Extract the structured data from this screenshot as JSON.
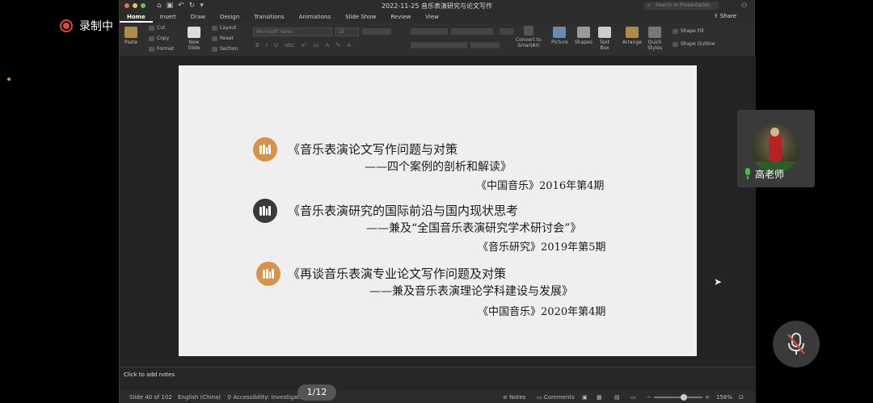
{
  "recording": {
    "label": "录制中"
  },
  "window": {
    "title": "2022-11-25 音乐表演研究与论文写作",
    "search_placeholder": "Search in Presentation",
    "share_label": "Share",
    "tabs": [
      "Home",
      "Insert",
      "Draw",
      "Design",
      "Transitions",
      "Animations",
      "Slide Show",
      "Review",
      "View"
    ]
  },
  "ribbon": {
    "paste": "Paste",
    "cut": "Cut",
    "copy": "Copy",
    "format": "Format",
    "new_slide": "New\nSlide",
    "layout": "Layout",
    "reset": "Reset",
    "section": "Section",
    "font_name": "Microsoft YaHei",
    "font_size": "18",
    "convert": "Convert to\nSmartArt",
    "picture": "Picture",
    "shapes": "Shapes",
    "text_box": "Text\nBox",
    "arrange": "Arrange",
    "quick_styles": "Quick\nStyles",
    "shape_fill": "Shape Fill",
    "shape_outline": "Shape Outline"
  },
  "slide": {
    "entries": [
      {
        "title": "《音乐表演论文写作问题与对策",
        "subtitle": "——四个案例的剖析和解读》",
        "source": "《中国音乐》2016年第4期",
        "badge_color": "#d8924a"
      },
      {
        "title": "《音乐表演研究的国际前沿与国内现状思考",
        "subtitle": "——兼及“全国音乐表演研究学术研讨会”》",
        "source": "《音乐研究》2019年第5期",
        "badge_color": "#3a3a3a"
      },
      {
        "title": "《再谈音乐表演专业论文写作问题及对策",
        "subtitle": "——兼及音乐表演理论学科建设与发展》",
        "source": "《中国音乐》2020年第4期",
        "badge_color": "#d8924a"
      }
    ]
  },
  "notes": {
    "placeholder": "Click to add notes"
  },
  "status": {
    "slide_info": "Slide 40 of 102",
    "language": "English (China)",
    "accessibility": "Accessibility: Investigate",
    "notes": "Notes",
    "comments": "Comments",
    "zoom": "156%",
    "zoom_level": 0.62
  },
  "pager": {
    "label": "1/12"
  },
  "participant": {
    "name": "高老师"
  }
}
